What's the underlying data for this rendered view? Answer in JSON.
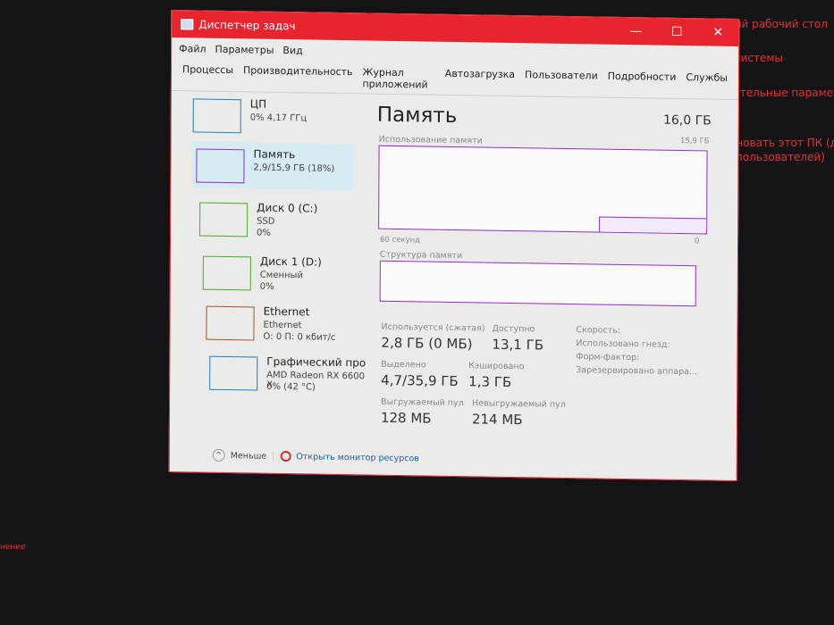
{
  "background": {
    "lines": [
      "ый рабочий стол",
      "системы",
      "ительные параметр",
      "еновать этот ПК (для",
      "х пользователей)",
      "нение"
    ]
  },
  "window": {
    "title": "Диспетчер задач",
    "controls": [
      "—",
      "☐",
      "✕"
    ],
    "menu": [
      "Файл",
      "Параметры",
      "Вид"
    ],
    "tabs": [
      "Процессы",
      "Производительность",
      "Журнал приложений",
      "Автозагрузка",
      "Пользователи",
      "Подробности",
      "Службы"
    ],
    "sidebar": [
      {
        "name": "ЦП",
        "l1": "0% 4,17 ГГц",
        "l2": "",
        "color": "#1d7fc4"
      },
      {
        "name": "Память",
        "l1": "2,9/15,9 ГБ (18%)",
        "l2": "",
        "color": "#8b2fc9"
      },
      {
        "name": "Диск 0 (C:)",
        "l1": "SSD",
        "l2": "0%",
        "color": "#4da630"
      },
      {
        "name": "Диск 1 (D:)",
        "l1": "Сменный",
        "l2": "0%",
        "color": "#4da630"
      },
      {
        "name": "Ethernet",
        "l1": "Ethernet",
        "l2": "О: 0 П: 0 кбит/с",
        "color": "#a6532d"
      },
      {
        "name": "Графический про",
        "l1": "AMD Radeon RX 6600 X",
        "l2": "0% (42 °C)",
        "color": "#1d7fc4"
      }
    ],
    "main": {
      "title": "Память",
      "total": "16,0 ГБ",
      "usage_label": "Использование памяти",
      "usage_max": "15,9 ГБ",
      "x_left": "60 секунд",
      "x_right": "0",
      "structure_label": "Структура памяти",
      "usage_fraction": 0.18,
      "stats": [
        {
          "label": "Используется (сжатая)",
          "value": "2,8 ГБ (0 МБ)"
        },
        {
          "label": "Доступно",
          "value": "13,1 ГБ"
        },
        {
          "label": "Выделено",
          "value": "4,7/35,9 ГБ"
        },
        {
          "label": "Кэшировано",
          "value": "1,3 ГБ"
        },
        {
          "label": "Выгружаемый пул",
          "value": "128 МБ"
        },
        {
          "label": "Невыгружаемый пул",
          "value": "214 МБ"
        }
      ],
      "props": [
        "Скорость:",
        "Использовано гнезд:",
        "Форм-фактор:",
        "Зарезервировано аппара..."
      ]
    },
    "footer": {
      "less": "Меньше",
      "monitor": "Открыть монитор ресурсов"
    }
  }
}
